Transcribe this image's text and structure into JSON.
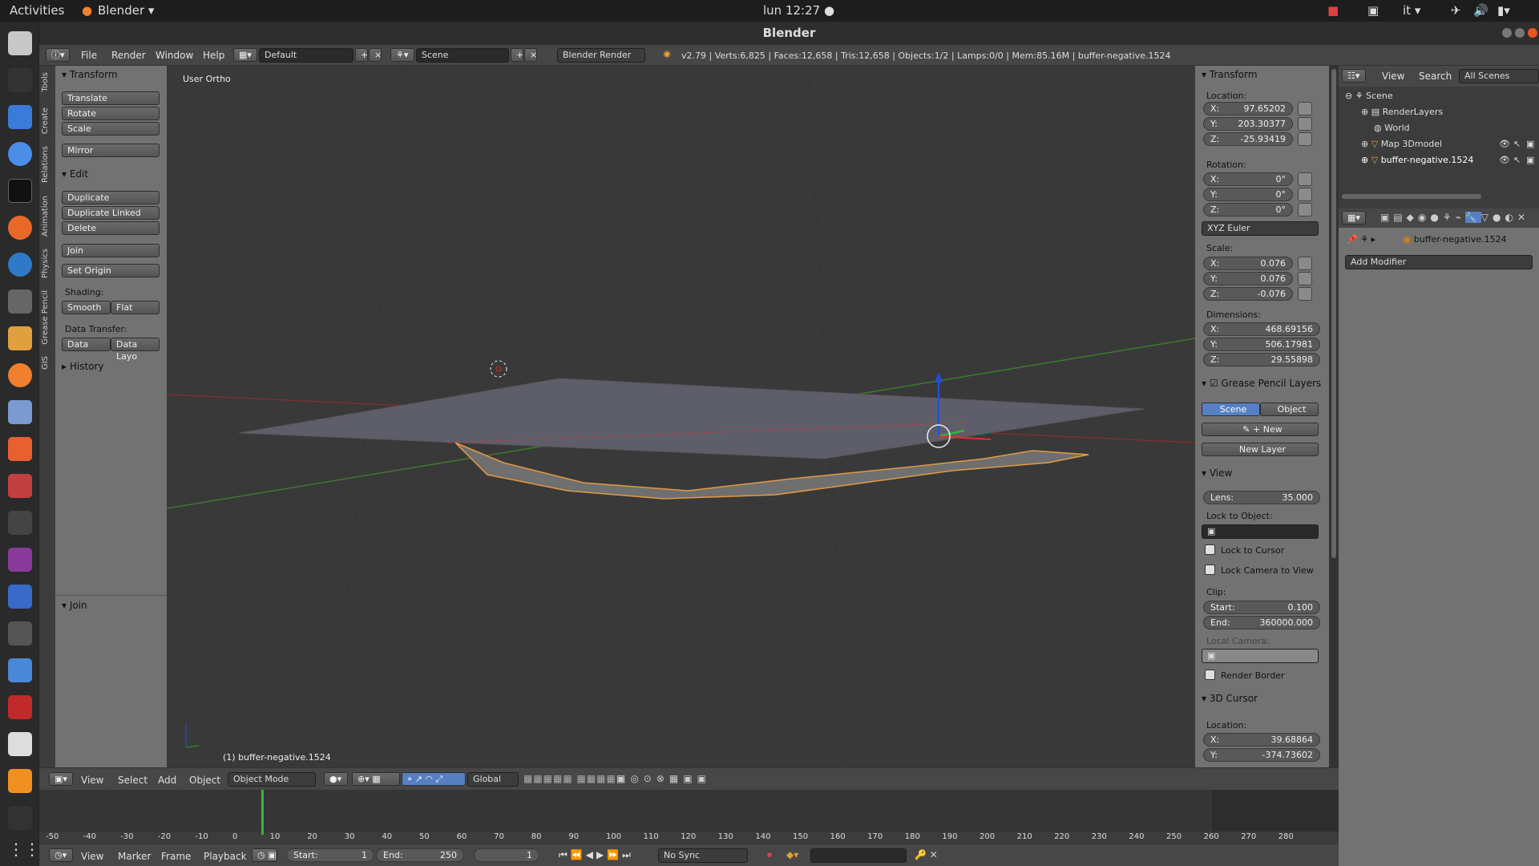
{
  "topbar": {
    "activities": "Activities",
    "app_menu": "Blender ▾",
    "clock": "lun 12:27 ●",
    "lang": "it ▾"
  },
  "window": {
    "title": "Blender"
  },
  "infobar": {
    "menus": [
      "File",
      "Render",
      "Window",
      "Help"
    ],
    "layout": "Default",
    "scene": "Scene",
    "engine": "Blender Render",
    "stats": "v2.79 | Verts:6,825 | Faces:12,658 | Tris:12,658 | Objects:1/2 | Lamps:0/0 | Mem:85.16M | buffer-negative.1524"
  },
  "tabs": [
    "Tools",
    "Create",
    "Relations",
    "Animation",
    "Physics",
    "Grease Pencil",
    "GIS"
  ],
  "toolshelf": {
    "transform_title": "Transform",
    "translate": "Translate",
    "rotate": "Rotate",
    "scale": "Scale",
    "mirror": "Mirror",
    "edit_title": "Edit",
    "duplicate": "Duplicate",
    "duplicate_linked": "Duplicate Linked",
    "delete": "Delete",
    "join": "Join",
    "set_origin": "Set Origin",
    "shading_label": "Shading:",
    "smooth": "Smooth",
    "flat": "Flat",
    "data_transfer_label": "Data Transfer:",
    "data": "Data",
    "data_layo": "Data Layo",
    "history_title": "History",
    "join_title": "Join"
  },
  "viewport": {
    "view_label": "User Ortho",
    "object_label": "(1) buffer-negative.1524"
  },
  "npanel": {
    "transform_title": "Transform",
    "location_label": "Location:",
    "loc_x": "97.65202",
    "loc_y": "203.30377",
    "loc_z": "-25.93419",
    "rotation_label": "Rotation:",
    "rot_x": "0°",
    "rot_y": "0°",
    "rot_z": "0°",
    "rot_mode": "XYZ Euler",
    "scale_label": "Scale:",
    "scale_x": "0.076",
    "scale_y": "0.076",
    "scale_z": "-0.076",
    "dimensions_label": "Dimensions:",
    "dim_x": "468.69156",
    "dim_y": "506.17981",
    "dim_z": "29.55898",
    "gp_title": "Grease Pencil Layers",
    "gp_scene": "Scene",
    "gp_object": "Object",
    "gp_new": "New",
    "gp_new_layer": "New Layer",
    "view_title": "View",
    "lens_label": "Lens:",
    "lens": "35.000",
    "lock_to_object": "Lock to Object:",
    "lock_to_cursor": "Lock to Cursor",
    "lock_camera": "Lock Camera to View",
    "clip_label": "Clip:",
    "clip_start_label": "Start:",
    "clip_start": "0.100",
    "clip_end_label": "End:",
    "clip_end": "360000.000",
    "local_camera": "Local Camera:",
    "render_border": "Render Border",
    "cursor_title": "3D Cursor",
    "cursor_location": "Location:",
    "cursor_x": "39.68864",
    "cursor_y": "-374.73602"
  },
  "outliner": {
    "view": "View",
    "search": "Search",
    "all_scenes": "All Scenes",
    "items": [
      "Scene",
      "RenderLayers",
      "World",
      "Map 3Dmodel",
      "buffer-negative.1524"
    ]
  },
  "props": {
    "object_name": "buffer-negative.1524",
    "add_modifier": "Add Modifier"
  },
  "vheader": {
    "menus": [
      "View",
      "Select",
      "Add",
      "Object"
    ],
    "mode": "Object Mode",
    "orientation": "Global"
  },
  "timeline": {
    "ticks": [
      "-50",
      "-40",
      "-30",
      "-20",
      "-10",
      "0",
      "10",
      "20",
      "30",
      "40",
      "50",
      "60",
      "70",
      "80",
      "90",
      "100",
      "110",
      "120",
      "130",
      "140",
      "150",
      "160",
      "170",
      "180",
      "190",
      "200",
      "210",
      "220",
      "230",
      "240",
      "250",
      "260",
      "270",
      "280"
    ]
  },
  "theader": {
    "menus": [
      "View",
      "Marker",
      "Frame",
      "Playback"
    ],
    "start_label": "Start:",
    "start": "1",
    "end_label": "End:",
    "end": "250",
    "current": "1",
    "sync": "No Sync"
  }
}
